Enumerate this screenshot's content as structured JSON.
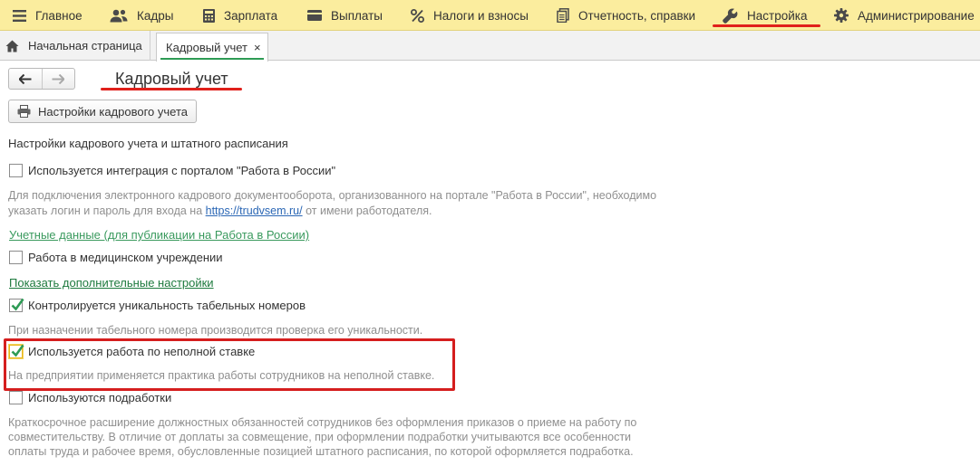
{
  "menu": {
    "items": [
      {
        "label": "Главное",
        "icon": "hamburger-icon"
      },
      {
        "label": "Кадры",
        "icon": "people-icon"
      },
      {
        "label": "Зарплата",
        "icon": "calculator-icon"
      },
      {
        "label": "Выплаты",
        "icon": "wallet-icon"
      },
      {
        "label": "Налоги и взносы",
        "icon": "percent-icon"
      },
      {
        "label": "Отчетность, справки",
        "icon": "documents-icon"
      },
      {
        "label": "Настройка",
        "icon": "wrench-icon"
      },
      {
        "label": "Администрирование",
        "icon": "gear-icon"
      }
    ]
  },
  "tabs": {
    "home_label": "Начальная страница",
    "active_label": "Кадровый учет",
    "close_glyph": "×"
  },
  "page": {
    "title": "Кадровый учет",
    "settings_button_label": "Настройки кадрового учета",
    "section_heading": "Настройки кадрового учета и штатного расписания"
  },
  "options": {
    "portal": {
      "label": "Используется интеграция с порталом \"Работа в России\"",
      "checked": false,
      "hint_line1": "Для подключения электронного кадрового документооборота, организованного на портале \"Работа в России\", необходимо",
      "hint_line2_before": "указать логин и пароль для входа на ",
      "hint_link": "https://trudvsem.ru/",
      "hint_line2_after": " от имени работодателя."
    },
    "credentials_link": "Учетные данные (для публикации на Работа в России)",
    "medical": {
      "label": "Работа в медицинском учреждении",
      "checked": false
    },
    "more_settings_link": "Показать дополнительные настройки",
    "unique_numbers": {
      "label": "Контролируется уникальность табельных номеров",
      "checked": true,
      "hint": "При назначении табельного номера производится проверка его уникальности."
    },
    "part_time": {
      "label": "Используется работа по неполной ставке",
      "checked": true,
      "hint": "На предприятии применяется практика работы сотрудников на неполной ставке."
    },
    "side_jobs": {
      "label": "Используются подработки",
      "checked": false,
      "hint_line1": "Краткосрочное расширение должностных обязанностей сотрудников без оформления приказов о приеме на работу по",
      "hint_line2": "совместительству. В отличие от доплаты за совмещение, при оформлении подработки учитываются все особенности",
      "hint_line3": "оплаты труда и рабочее время, обусловленные позицией штатного расписания, по которой оформляется подработка."
    }
  },
  "colors": {
    "menubar": "#fbed9e",
    "accent_green": "#2e9b55",
    "annotation_red": "#e0201b",
    "hint_gray": "#8f8f8f",
    "link_blue": "#2b67b5"
  }
}
